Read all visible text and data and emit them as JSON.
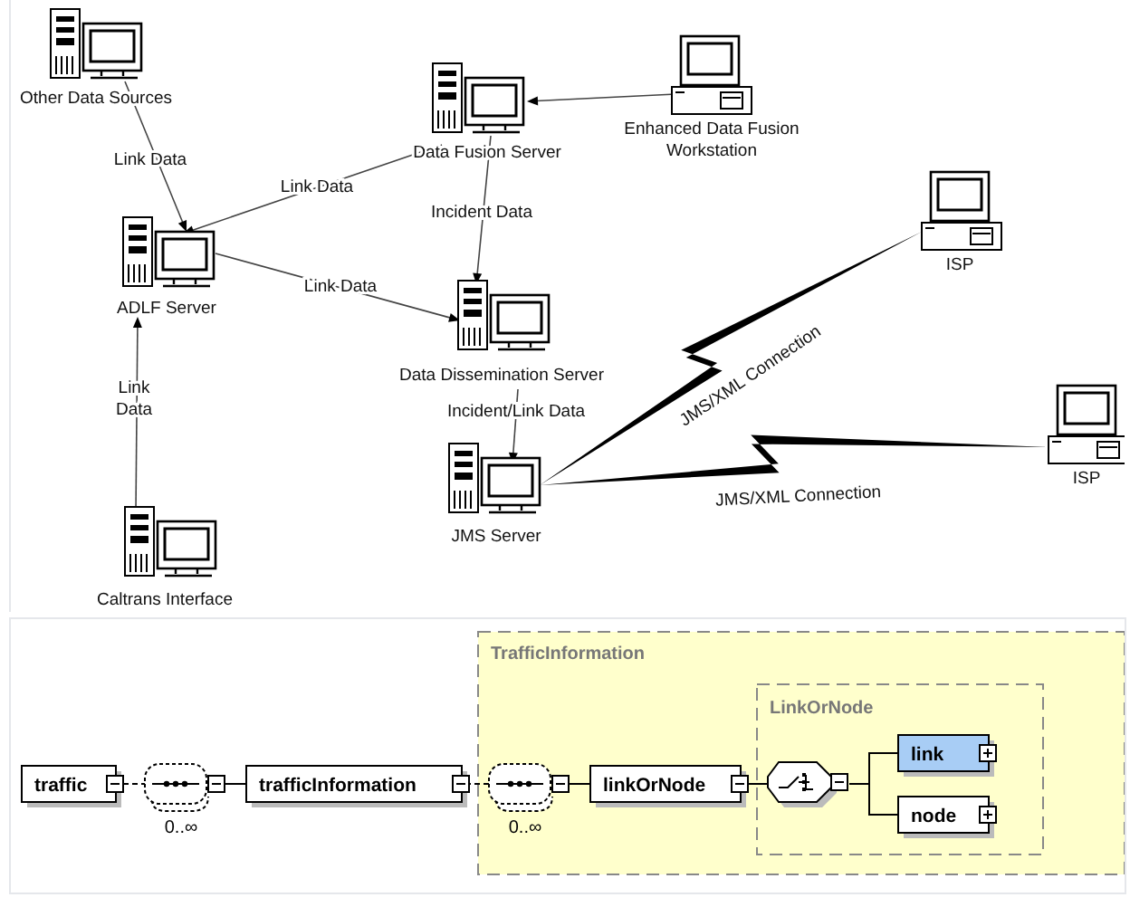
{
  "network_diagram": {
    "nodes": [
      {
        "label": [
          "Other Data Sources"
        ],
        "kind": "server"
      },
      {
        "label": [
          "Data Fusion Server"
        ],
        "kind": "server"
      },
      {
        "label": [
          "Enhanced Data Fusion",
          "Workstation"
        ],
        "kind": "workstation"
      },
      {
        "label": [
          "ADLF Server"
        ],
        "kind": "server"
      },
      {
        "label": [
          "Data Dissemination Server"
        ],
        "kind": "server"
      },
      {
        "label": [
          "JMS Server"
        ],
        "kind": "server"
      },
      {
        "label": [
          "ISP"
        ],
        "kind": "workstation"
      },
      {
        "label": [
          "ISP"
        ],
        "kind": "workstation"
      },
      {
        "label": [
          "Caltrans Interface"
        ],
        "kind": "server"
      }
    ],
    "connections": [
      {
        "label": [
          "Link Data"
        ],
        "kind": "arrow"
      },
      {
        "label": [
          "Link Data"
        ],
        "kind": "arrow"
      },
      {
        "label": [
          "Incident Data"
        ],
        "kind": "arrow"
      },
      {
        "label": [
          "Link Data"
        ],
        "kind": "arrow"
      },
      {
        "kind": "arrow"
      },
      {
        "label": [
          "Link",
          "Data"
        ],
        "kind": "arrow"
      },
      {
        "label": [
          "Incident/Link Data"
        ],
        "kind": "arrow"
      },
      {
        "label": [
          "JMS/XML Connection"
        ],
        "kind": "lightning"
      },
      {
        "label": [
          "JMS/XML Connection"
        ],
        "kind": "lightning"
      }
    ]
  },
  "schema_diagram": {
    "groups": [
      {
        "title": "TrafficInformation"
      },
      {
        "title": "LinkOrNode"
      }
    ],
    "elements": [
      {
        "label": "traffic",
        "expanded": true,
        "selected": false
      },
      {
        "label": "trafficInformation",
        "expanded": true,
        "selected": false
      },
      {
        "label": "linkOrNode",
        "expanded": true,
        "selected": false
      },
      {
        "label": "link",
        "expanded": false,
        "selected": true
      },
      {
        "label": "node",
        "expanded": false,
        "selected": false
      }
    ],
    "compositors": [
      {
        "kind": "sequence",
        "occurrence": "0..∞",
        "expanded": true
      },
      {
        "kind": "sequence",
        "occurrence": "0..∞",
        "expanded": true
      },
      {
        "kind": "choice",
        "expanded": true
      }
    ]
  }
}
